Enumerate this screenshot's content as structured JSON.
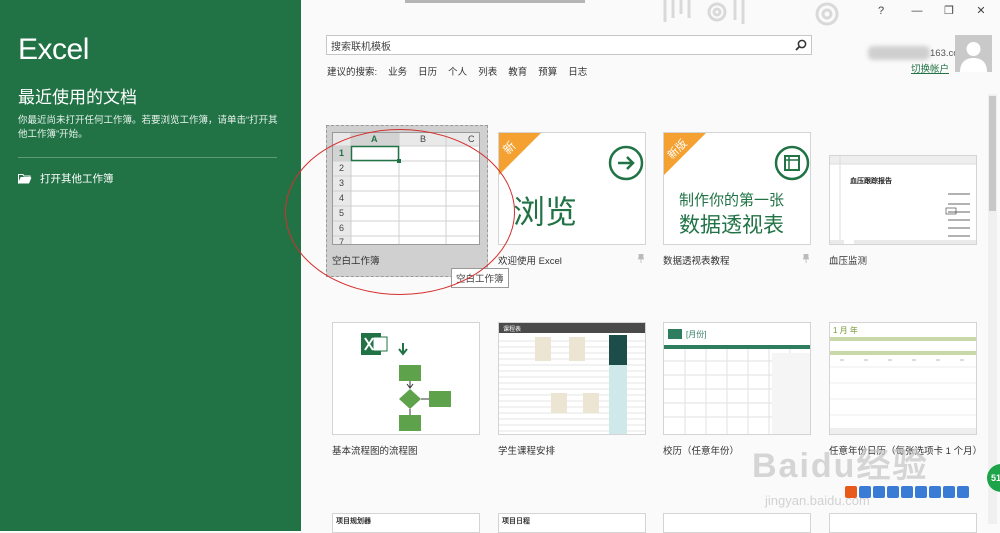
{
  "left": {
    "app_name": "Excel",
    "section_title": "最近使用的文档",
    "empty_message": "你最近尚未打开任何工作簿。若要浏览工作簿，请单击“打开其他工作簿”开始。",
    "open_other": "打开其他工作簿"
  },
  "window": {
    "help": "?",
    "minimize": "—",
    "restore": "❐",
    "close": "✕"
  },
  "search": {
    "value": "搜索联机模板"
  },
  "suggested": {
    "label": "建议的搜索:",
    "items": [
      "业务",
      "日历",
      "个人",
      "列表",
      "教育",
      "预算",
      "日志"
    ]
  },
  "account": {
    "email": "163.com",
    "switch_label": "切换帐户"
  },
  "tiles": [
    {
      "name": "空白工作簿",
      "pinned": false
    },
    {
      "name": "欢迎使用 Excel",
      "badge": "新",
      "headline": "浏览",
      "pinned": true
    },
    {
      "name": "数据透视表教程",
      "badge": "新版",
      "headline_line1": "制作你的第一张",
      "headline_line2": "数据透视表",
      "pinned": true
    },
    {
      "name": "血压监测",
      "doc_title": "血压跟踪报告"
    },
    {
      "name": "基本流程图的流程图"
    },
    {
      "name": "学生课程安排",
      "sheet_title": "课程表"
    },
    {
      "name": "校历（任意年份）",
      "cal_label": "[月份]"
    },
    {
      "name": "任意年份日历（每张选项卡 1 个月）",
      "cal_label": "1 月 年"
    }
  ],
  "blank_grid": {
    "columns": [
      "A",
      "B",
      "C"
    ],
    "rows": [
      "1",
      "2",
      "3",
      "4",
      "5",
      "6",
      "7"
    ]
  },
  "tooltip": "空白工作簿",
  "partial_tiles": [
    "项目规划器",
    "项目日程",
    "",
    ""
  ],
  "watermark": {
    "main": "Baidu经验",
    "sub": "jingyan.baidu.com"
  },
  "colors": {
    "excel_green": "#217346",
    "accent_orange": "#f4a132",
    "annotation_red": "#d42f2f"
  }
}
